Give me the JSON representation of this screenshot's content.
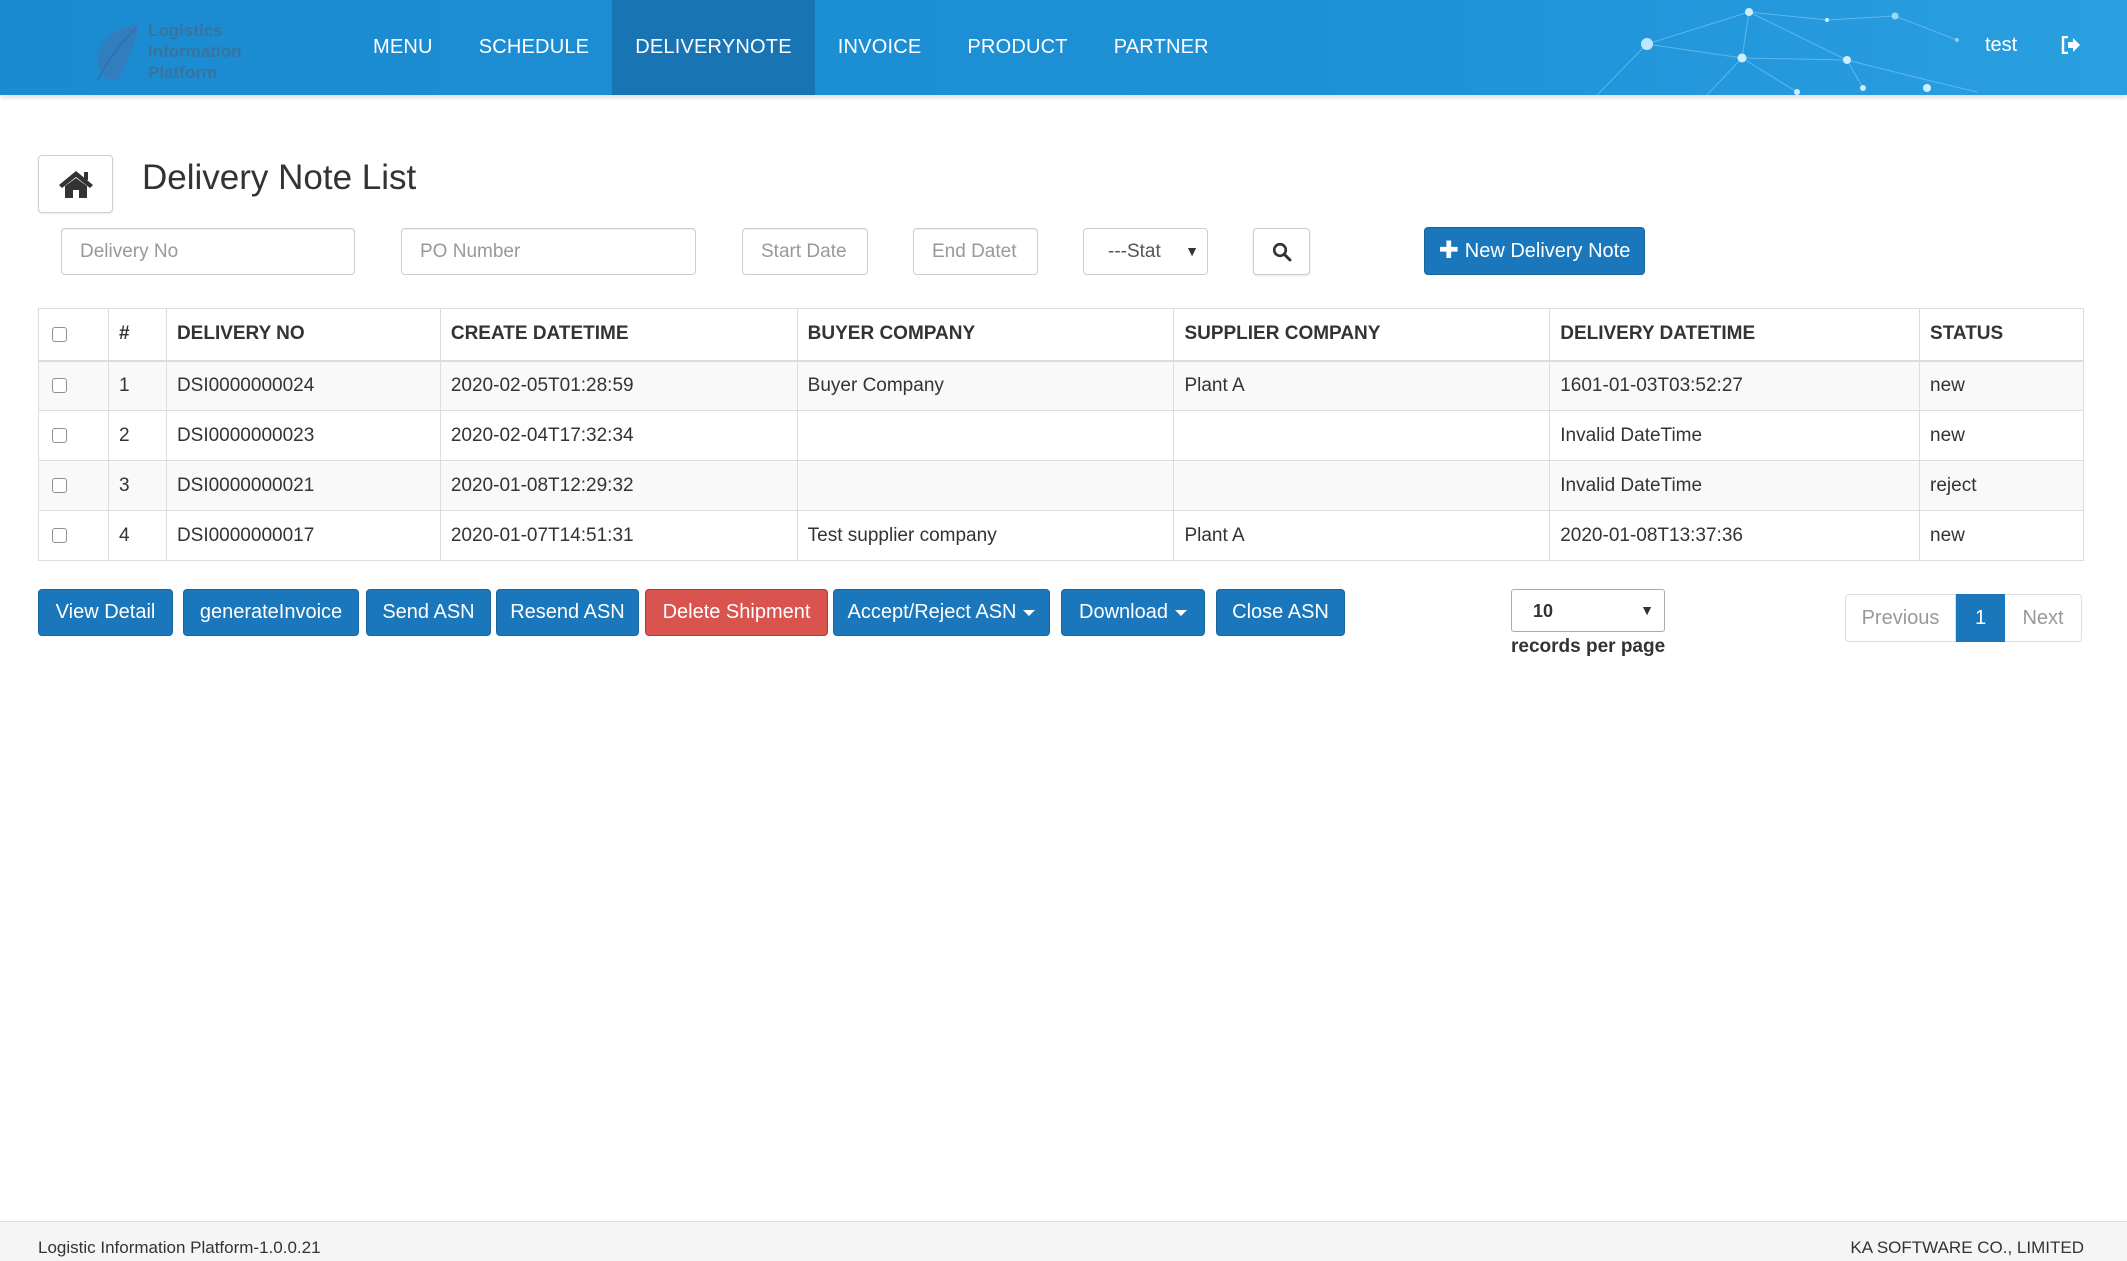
{
  "header": {
    "logo_lines": [
      "Logistics",
      "Information",
      "Platform"
    ],
    "nav": [
      {
        "label": "MENU",
        "active": false
      },
      {
        "label": "SCHEDULE",
        "active": false
      },
      {
        "label": "DELIVERYNOTE",
        "active": true
      },
      {
        "label": "INVOICE",
        "active": false
      },
      {
        "label": "PRODUCT",
        "active": false
      },
      {
        "label": "PARTNER",
        "active": false
      }
    ],
    "user": "test"
  },
  "page": {
    "title": "Delivery Note List",
    "home_icon": "home-icon"
  },
  "filters": {
    "delivery_no_placeholder": "Delivery No",
    "po_number_placeholder": "PO Number",
    "start_date_placeholder": "Start Date",
    "end_date_placeholder": "End Datet",
    "status_select": "---Stat",
    "search_icon": "search-icon",
    "new_button": "New Delivery Note"
  },
  "table": {
    "headers": [
      "#",
      "DELIVERY NO",
      "CREATE DATETIME",
      "BUYER COMPANY",
      "SUPPLIER COMPANY",
      "DELIVERY DATETIME",
      "STATUS"
    ],
    "rows": [
      {
        "num": "1",
        "delivery_no": "DSI0000000024",
        "create": "2020-02-05T01:28:59",
        "buyer": "Buyer Company",
        "supplier": "Plant A",
        "delivery": "1601-01-03T03:52:27",
        "status": "new"
      },
      {
        "num": "2",
        "delivery_no": "DSI0000000023",
        "create": "2020-02-04T17:32:34",
        "buyer": "",
        "supplier": "",
        "delivery": "Invalid DateTime",
        "status": "new"
      },
      {
        "num": "3",
        "delivery_no": "DSI0000000021",
        "create": "2020-01-08T12:29:32",
        "buyer": "",
        "supplier": "",
        "delivery": "Invalid DateTime",
        "status": "reject"
      },
      {
        "num": "4",
        "delivery_no": "DSI0000000017",
        "create": "2020-01-07T14:51:31",
        "buyer": "Test supplier company",
        "supplier": "Plant A",
        "delivery": "2020-01-08T13:37:36",
        "status": "new"
      }
    ]
  },
  "actions": {
    "view_detail": "View Detail",
    "generate_invoice": "generateInvoice",
    "send_asn": "Send ASN",
    "resend_asn": "Resend ASN",
    "delete_shipment": "Delete Shipment",
    "accept_reject": "Accept/Reject ASN",
    "download": "Download",
    "close_asn": "Close ASN"
  },
  "paging": {
    "records_per_page_value": "10",
    "records_per_page_label": "records per page",
    "previous": "Previous",
    "current": "1",
    "next": "Next"
  },
  "footer": {
    "left": "Logistic Information Platform-1.0.0.21",
    "right": "KA SOFTWARE CO., LIMITED"
  },
  "colors": {
    "header_bg": "#1d90d6",
    "nav_active": "#1874b3",
    "primary": "#1b77bb",
    "danger": "#d9534f"
  }
}
